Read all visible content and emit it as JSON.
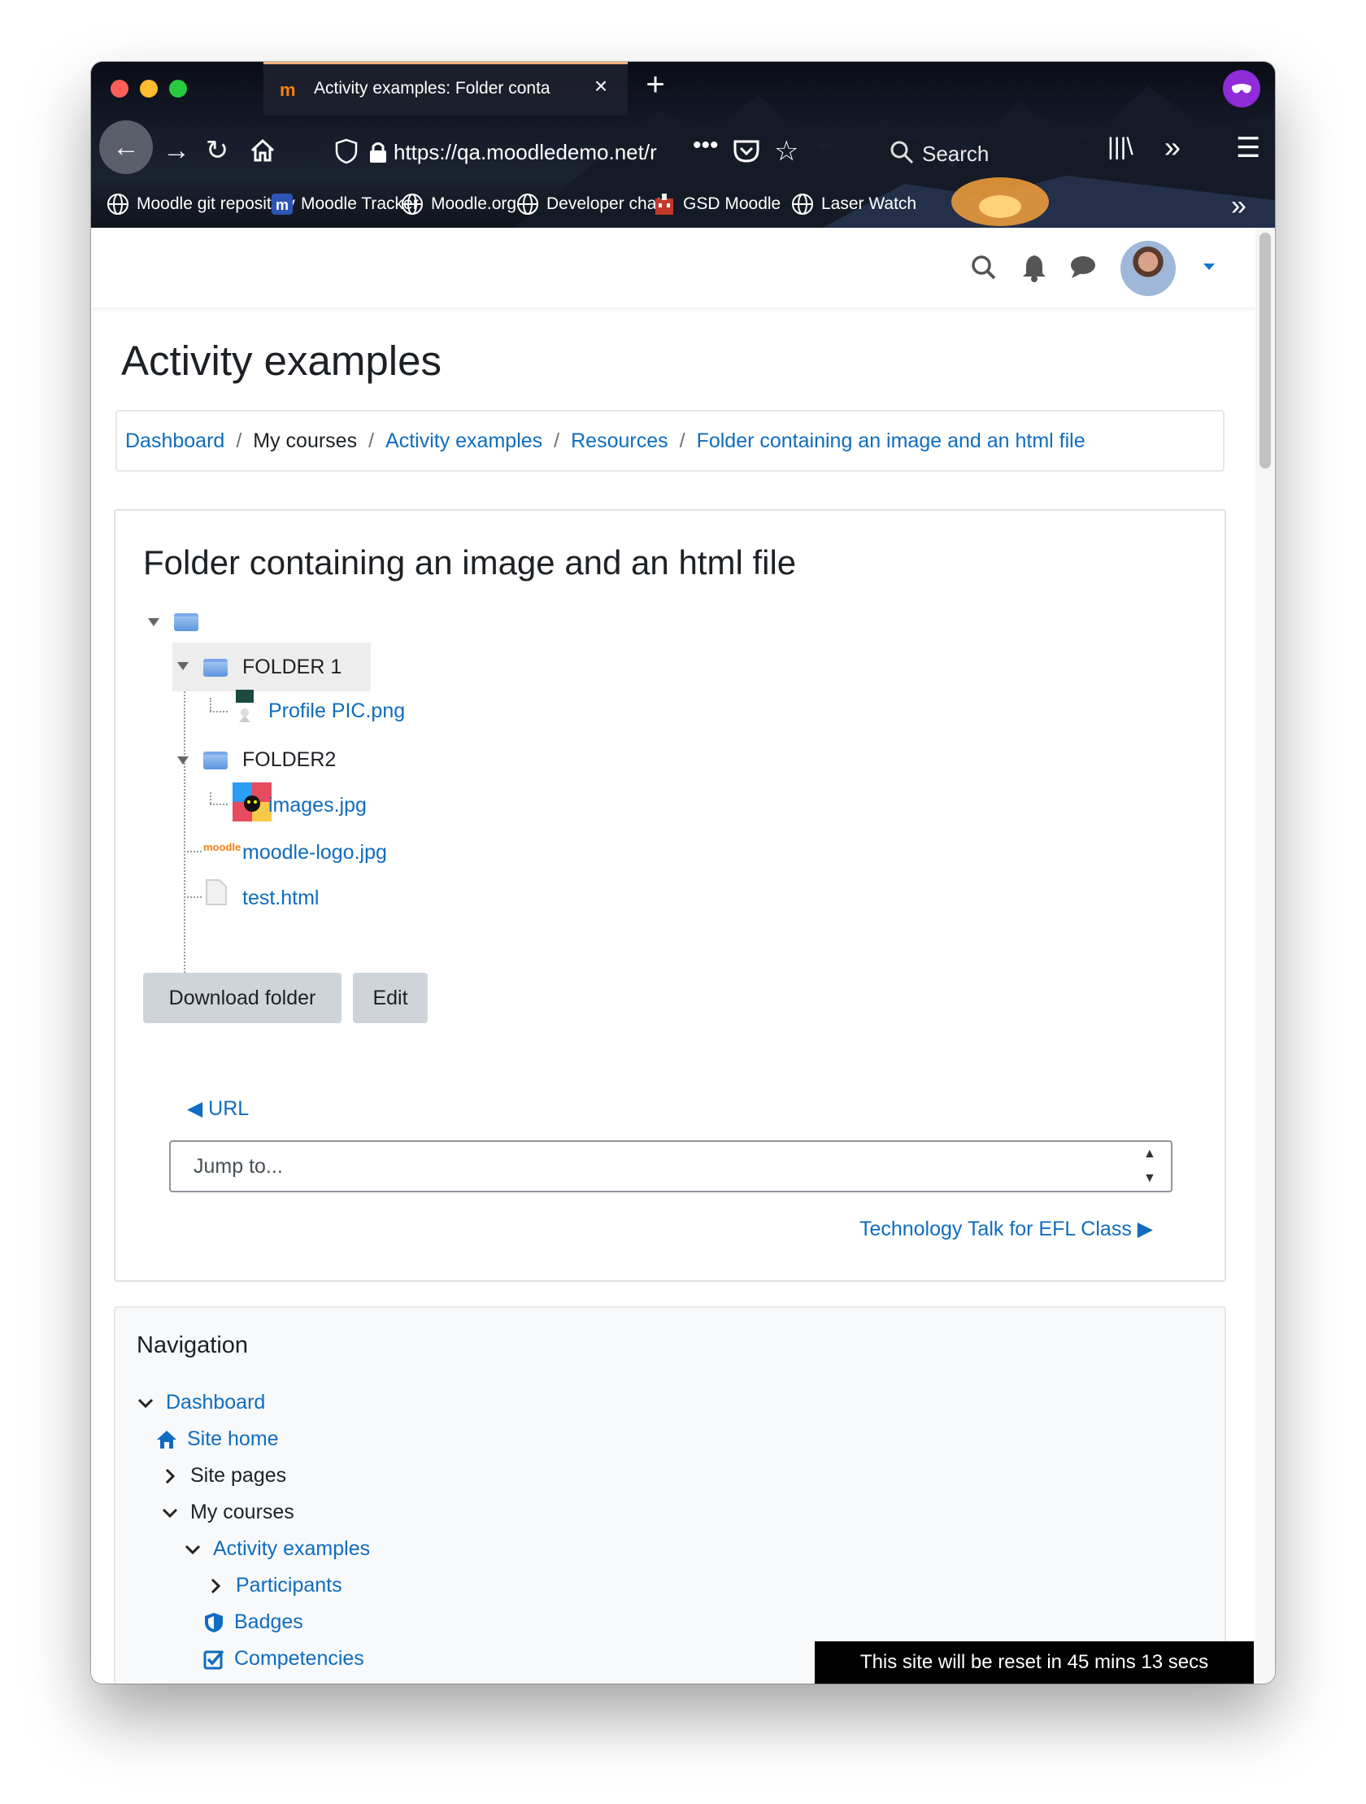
{
  "browser": {
    "tab_title": "Activity examples: Folder conta",
    "url": "https://qa.moodledemo.net/r",
    "search_placeholder": "Search",
    "bookmarks": [
      {
        "label": "Moodle git repository",
        "icon": "globe-icon"
      },
      {
        "label": "Moodle Tracker",
        "icon": "moodle-icon"
      },
      {
        "label": "Moodle.org",
        "icon": "globe-icon"
      },
      {
        "label": "Developer chat",
        "icon": "globe-icon"
      },
      {
        "label": "GSD Moodle",
        "icon": "gsd-icon"
      },
      {
        "label": "Laser Watch",
        "icon": "globe-icon"
      }
    ]
  },
  "page": {
    "title": "Activity examples",
    "breadcrumb": [
      {
        "label": "Dashboard",
        "link": true
      },
      {
        "label": "My courses",
        "link": false
      },
      {
        "label": "Activity examples",
        "link": true
      },
      {
        "label": "Resources",
        "link": true
      },
      {
        "label": "Folder containing an image and an html file",
        "link": true
      }
    ]
  },
  "folder": {
    "heading": "Folder containing an image and an html file",
    "tree": {
      "folder1": "FOLDER 1",
      "profile": "Profile PIC.png",
      "folder2": "FOLDER2",
      "images": "images.jpg",
      "moodle_logo": "moodle-logo.jpg",
      "test": "test.html"
    },
    "download_label": "Download folder",
    "edit_label": "Edit",
    "prev_link": "◀ URL",
    "jump_placeholder": "Jump to...",
    "next_link": "Technology Talk for EFL Class ▶"
  },
  "navigation": {
    "heading": "Navigation",
    "items": [
      {
        "label": "Dashboard",
        "link": true
      },
      {
        "label": "Site home",
        "link": true
      },
      {
        "label": "Site pages",
        "link": false
      },
      {
        "label": "My courses",
        "link": false
      },
      {
        "label": "Activity examples",
        "link": true
      },
      {
        "label": "Participants",
        "link": true
      },
      {
        "label": "Badges",
        "link": true
      },
      {
        "label": "Competencies",
        "link": true
      }
    ]
  },
  "toast": "This site will be reset in 45 mins 13 secs",
  "colors": {
    "link": "#0f6cbf",
    "accent_orange": "#f98012",
    "private_purple": "#8f2bd8"
  }
}
